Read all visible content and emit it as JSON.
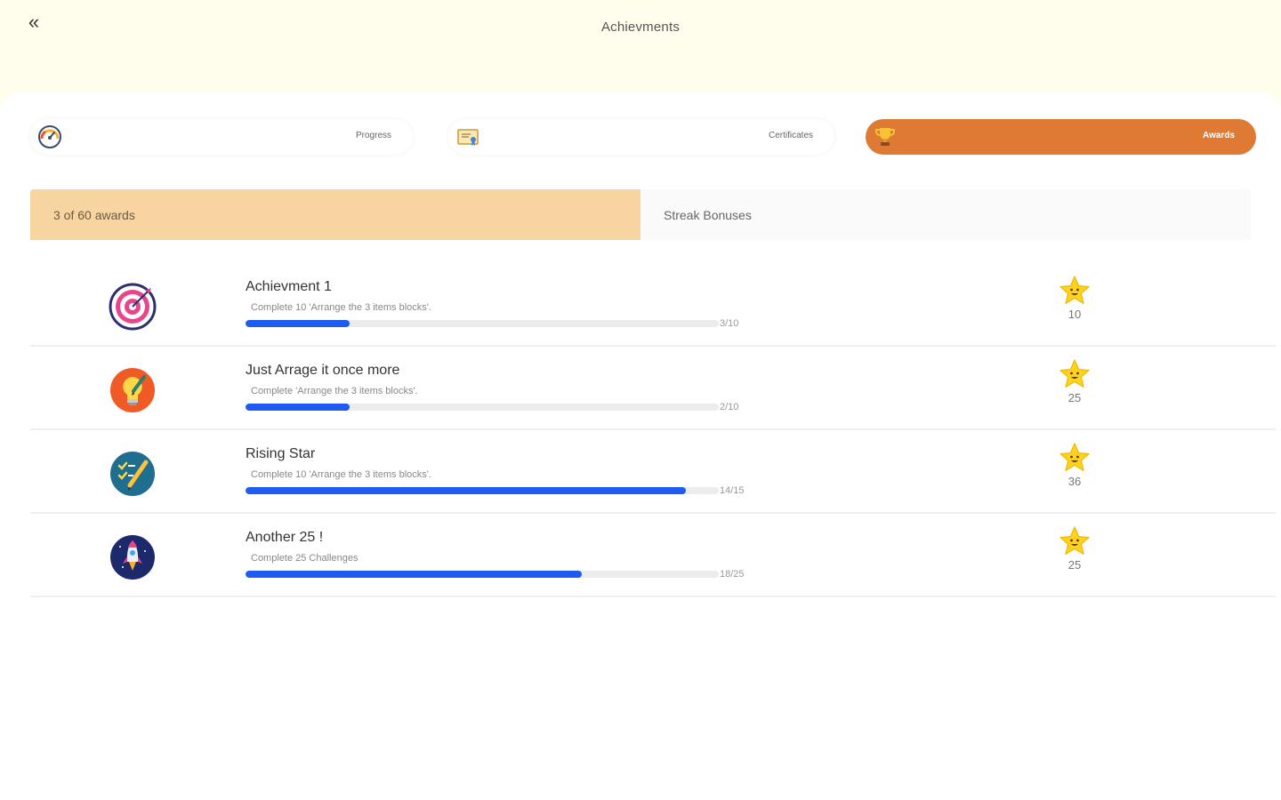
{
  "header": {
    "back_label": "«",
    "title": "Achievments"
  },
  "tabs": [
    {
      "label": "Progress",
      "icon": "speedometer-icon",
      "active": false
    },
    {
      "label": "Certificates",
      "icon": "certificate-icon",
      "active": false
    },
    {
      "label": "Awards",
      "icon": "trophy-icon",
      "active": true
    }
  ],
  "subtabs": [
    {
      "label": "3 of 60 awards",
      "active": true
    },
    {
      "label": "Streak Bonuses",
      "active": false
    }
  ],
  "achievements": [
    {
      "title": "Achievment 1",
      "description": "Complete 10 'Arrange the 3 items blocks'.",
      "progress_text": "3/10",
      "progress": 0.22,
      "points": "10",
      "icon": "target-icon"
    },
    {
      "title": "Just Arrage it once more",
      "description": "Complete 'Arrange the 3 items blocks'.",
      "progress_text": "2/10",
      "progress": 0.22,
      "points": "25",
      "icon": "lightbulb-icon"
    },
    {
      "title": "Rising Star",
      "description": "Complete 10 'Arrange the 3 items blocks'.",
      "progress_text": "14/15",
      "progress": 0.93,
      "points": "36",
      "icon": "checklist-pencil-icon"
    },
    {
      "title": "Another 25 !",
      "description": "Complete 25 Challenges",
      "progress_text": "18/25",
      "progress": 0.71,
      "points": "25",
      "icon": "rocket-icon"
    }
  ],
  "colors": {
    "header_bg": "#fffdec",
    "active_tab": "#df7a34",
    "active_subtab": "#f8d4a0",
    "progress_fill": "#1e5bf0",
    "progress_track": "#ececec",
    "star": "#ffd21f"
  }
}
